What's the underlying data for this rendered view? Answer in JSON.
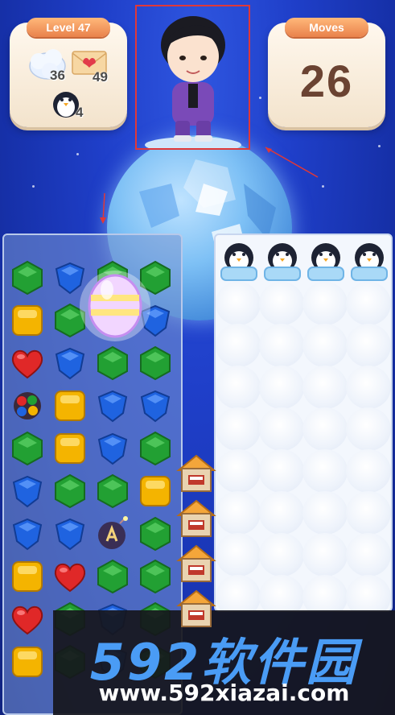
{
  "level_card": {
    "title": "Level 47",
    "goals": [
      {
        "icon": "snow-cloud-icon",
        "count": "36"
      },
      {
        "icon": "love-letter-icon",
        "count": "49"
      },
      {
        "icon": "penguin-icon",
        "count": "4"
      }
    ]
  },
  "moves_card": {
    "title": "Moves",
    "value": "26"
  },
  "watermark": {
    "brand": "592软件园",
    "url": "www.592xiazai.com"
  },
  "colors": {
    "background": "#1f3fc9",
    "card_tab": "#e9824b",
    "moves_text": "#6b4332",
    "highlight_box": "#e03838",
    "green_gem": "#22a033",
    "blue_gem": "#1f63e0",
    "yellow_gem": "#f4b400",
    "red_gem": "#e02828"
  }
}
